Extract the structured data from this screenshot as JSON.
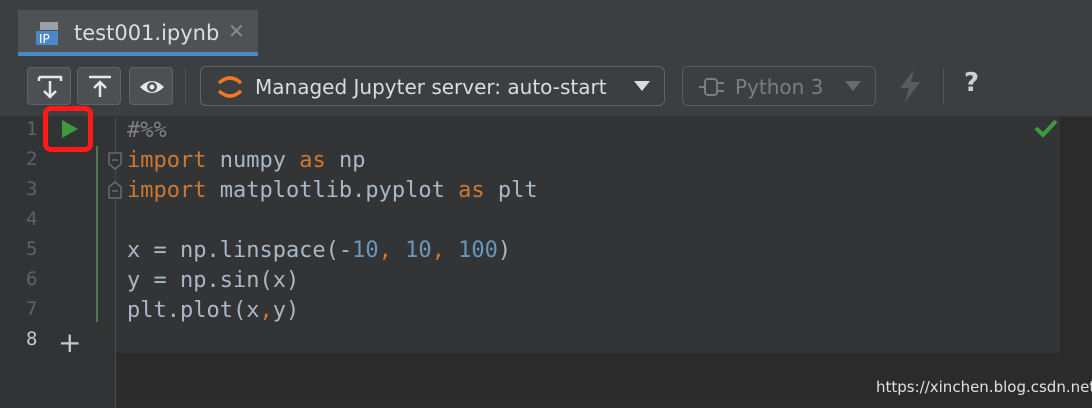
{
  "tab": {
    "title": "test001.ipynb",
    "close": "✕",
    "file_badge": "IP"
  },
  "toolbar": {
    "server_label": "Managed Jupyter server: auto-start",
    "kernel_label": "Python 3",
    "help": "?"
  },
  "gutter": {
    "line_numbers": [
      "1",
      "2",
      "3",
      "4",
      "5",
      "6",
      "7",
      "8"
    ],
    "add_cell": "+"
  },
  "code": {
    "l1": "#%%",
    "l2_kw1": "import",
    "l2_mod": " numpy ",
    "l2_kw2": "as",
    "l2_alias": " np",
    "l3_kw1": "import",
    "l3_mod": " matplotlib.pyplot ",
    "l3_kw2": "as",
    "l3_alias": " plt",
    "l5_a": "x = np.linspace(-",
    "l5_n1": "10",
    "l5_c1": ", ",
    "l5_n2": "10",
    "l5_c2": ", ",
    "l5_n3": "100",
    "l5_b": ")",
    "l6": "y = np.sin(x)",
    "l7_a": "plt.plot(x",
    "l7_comma": ",",
    "l7_b": "y)"
  },
  "watermark": "https://xinchen.blog.csdn.net",
  "colors": {
    "keyword": "#cc7832",
    "number": "#6897bb",
    "comment": "#808080",
    "run": "#3e9a3e",
    "check": "#3e9a3e"
  },
  "icons": [
    "download-icon",
    "upload-icon",
    "eye-icon",
    "jupyter-icon",
    "plug-icon",
    "lightning-icon",
    "run-icon",
    "check-icon"
  ]
}
